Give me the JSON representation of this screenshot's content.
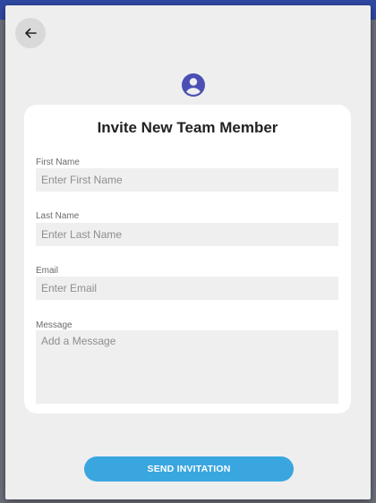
{
  "modal": {
    "title": "Invite New Team Member",
    "fields": {
      "first_name": {
        "label": "First Name",
        "placeholder": "Enter First Name",
        "value": ""
      },
      "last_name": {
        "label": "Last Name",
        "placeholder": "Enter Last Name",
        "value": ""
      },
      "email": {
        "label": "Email",
        "placeholder": "Enter Email",
        "value": ""
      },
      "message": {
        "label": "Message",
        "placeholder": "Add a Message",
        "value": ""
      }
    },
    "submit_label": "SEND INVITATION"
  },
  "icons": {
    "back": "arrow-left-icon",
    "avatar": "account-circle-icon"
  },
  "colors": {
    "accent": "#3aa6e0",
    "avatar": "#4b4fb4",
    "sheet": "#eeeeee",
    "card": "#ffffff"
  }
}
